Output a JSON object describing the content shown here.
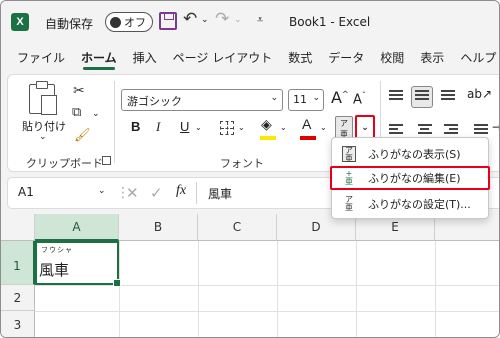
{
  "titlebar": {
    "app_icon": "X",
    "autosave_label": "自動保存",
    "autosave_state": "オフ",
    "title": "Book1  -  Excel",
    "icons": [
      "save-icon",
      "undo-icon",
      "redo-icon",
      "customize-quick-access-icon"
    ]
  },
  "tabs": [
    "ファイル",
    "ホーム",
    "挿入",
    "ページ レイアウト",
    "数式",
    "データ",
    "校閲",
    "表示",
    "ヘルプ"
  ],
  "active_tab": "ホーム",
  "ribbon": {
    "clipboard": {
      "paste_label": "貼り付け",
      "group_label": "クリップボード",
      "icons": [
        "paste-icon",
        "cut-icon",
        "copy-icon",
        "format-painter-icon",
        "dialog-launcher-icon"
      ]
    },
    "font": {
      "font_name": "游ゴシック",
      "font_size": "11",
      "grow_label": "A",
      "shrink_label": "A",
      "bold_label": "B",
      "italic_label": "I",
      "underline_label": "U",
      "font_color_label": "A",
      "phonetic_glyph": "ア\n亜",
      "group_label": "フォント",
      "fill_color": "#ffe800",
      "font_color": "#e00000"
    }
  },
  "phonetic_menu": {
    "items": [
      {
        "label": "ふりがなの表示(S)",
        "icon": "show-phonetic-icon",
        "highlighted": false
      },
      {
        "label": "ふりがなの編集(E)",
        "icon": "edit-phonetic-icon",
        "highlighted": true
      },
      {
        "label": "ふりがなの設定(T)...",
        "icon": "phonetic-settings-icon",
        "highlighted": false
      }
    ],
    "highlight_color": "#e8001a"
  },
  "formula_bar": {
    "name_box": "A1",
    "fx_label": "fx",
    "value": "風車"
  },
  "grid": {
    "columns": [
      "A",
      "B",
      "C",
      "D",
      "E"
    ],
    "rows": [
      "1",
      "2",
      "3"
    ],
    "selected_column": "A",
    "selected_row": "1",
    "cells": {
      "A1": {
        "value": "風車",
        "furigana": "フウシャ"
      }
    },
    "accent_color": "#1d7044"
  }
}
